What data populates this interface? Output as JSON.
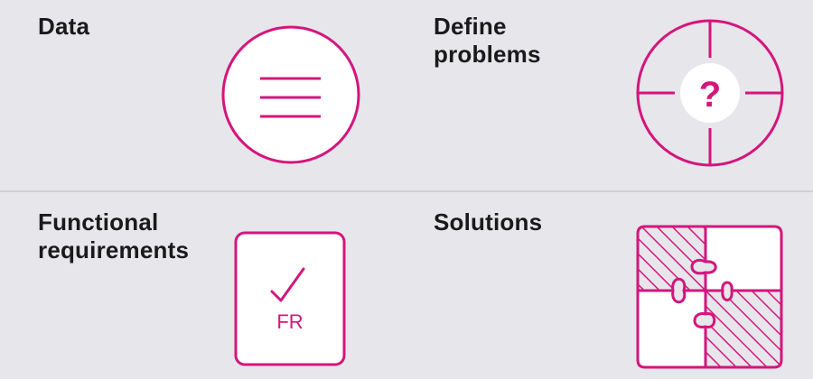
{
  "tiles": {
    "data": {
      "label": "Data",
      "icon": "list-lines-icon"
    },
    "define_problems": {
      "label": "Define\nproblems",
      "icon": "question-target-icon",
      "glyph": "?"
    },
    "functional_requirements": {
      "label": "Functional\nrequirements",
      "icon": "checklist-document-icon",
      "badge": "FR"
    },
    "solutions": {
      "label": "Solutions",
      "icon": "puzzle-pieces-icon"
    }
  },
  "colors": {
    "accent": "#d4157c",
    "background": "#e6e6eb",
    "text": "#1a1a1a",
    "divider": "#cfcfd4"
  }
}
